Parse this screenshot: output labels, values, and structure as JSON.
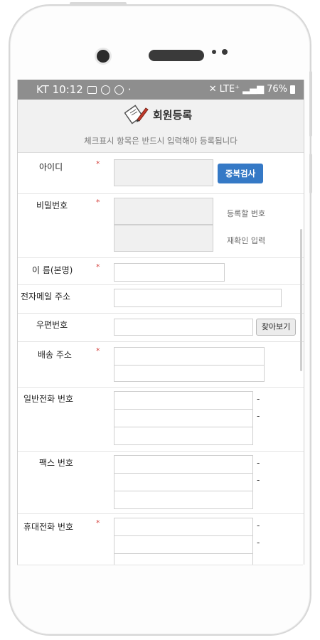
{
  "statusbar": {
    "carrier_time": "KT 10:12",
    "dot": "·",
    "network": "LTE⁺",
    "battery": "76%"
  },
  "header": {
    "title": "회원등록",
    "subtitle": "체크표시 항목은 반드시 입력해야 등록됩니다"
  },
  "form": {
    "required_mark": "*",
    "id": {
      "label": "아이디",
      "button": "중복검사"
    },
    "password": {
      "label": "비밀번호",
      "hint1": "등록할 번호",
      "hint2": "재확인 입력"
    },
    "name": {
      "label": "이 름(본명)"
    },
    "email": {
      "label": "전자메일 주소"
    },
    "zipcode": {
      "label": "우편번호",
      "button": "찾아보기"
    },
    "address": {
      "label": "배송 주소"
    },
    "phone": {
      "label": "일반전화 번호",
      "dash": "-"
    },
    "fax": {
      "label": "팩스 번호",
      "dash": "-"
    },
    "mobile": {
      "label": "휴대전화 번호",
      "dash": "-"
    }
  },
  "colors": {
    "accent": "#3579c6",
    "required": "#d64541",
    "statusbar": "#8e8e8e"
  }
}
